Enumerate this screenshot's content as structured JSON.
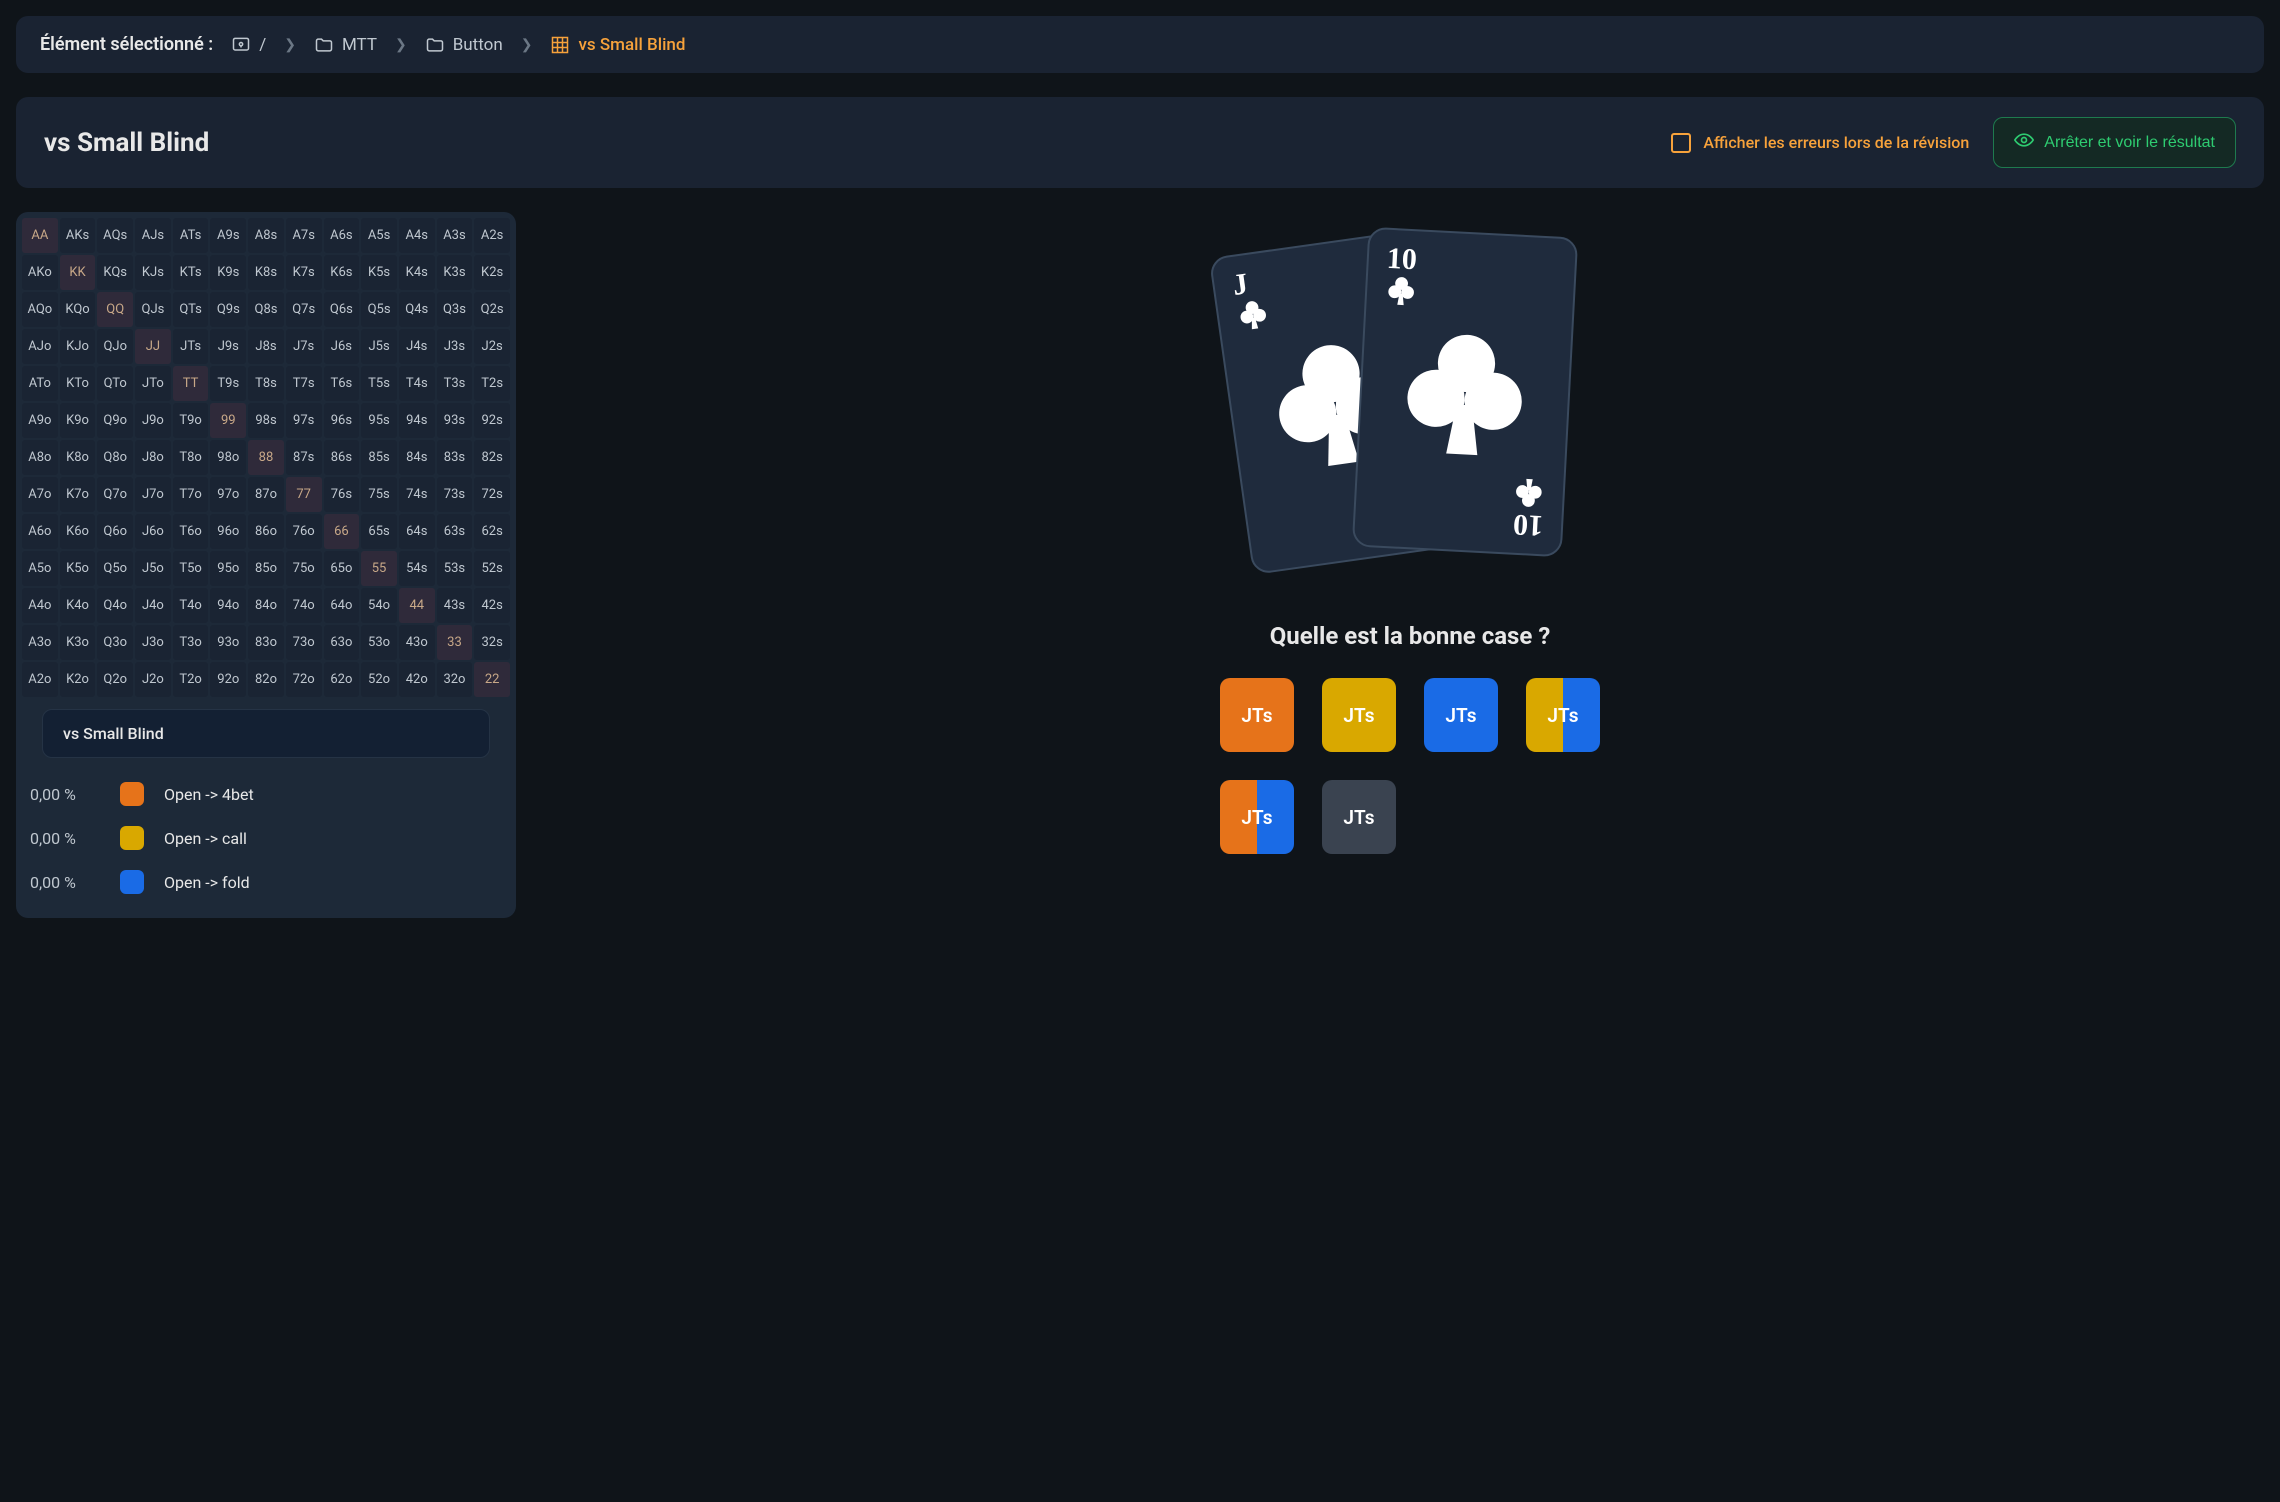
{
  "breadcrumb": {
    "label": "Élément sélectionné :",
    "root": "/",
    "items": [
      "MTT",
      "Button",
      "vs Small Blind"
    ]
  },
  "header": {
    "title": "vs Small Blind",
    "show_errors_label": "Afficher les erreurs lors de la révision",
    "stop_label": "Arrêter et voir le résultat"
  },
  "ranks": [
    "A",
    "K",
    "Q",
    "J",
    "T",
    "9",
    "8",
    "7",
    "6",
    "5",
    "4",
    "3",
    "2"
  ],
  "legend": {
    "title": "vs Small Blind",
    "rows": [
      {
        "pct": "0,00 %",
        "color": "orange",
        "label": "Open -> 4bet"
      },
      {
        "pct": "0,00 %",
        "color": "yellow",
        "label": "Open -> call"
      },
      {
        "pct": "0,00 %",
        "color": "blue",
        "label": "Open -> fold"
      }
    ]
  },
  "cards": {
    "c1_rank": "J",
    "c2_rank": "10",
    "c2_rank_bottom": "10"
  },
  "question": "Quelle est la bonne case ?",
  "answers": [
    {
      "label": "JTs",
      "fill": [
        [
          "orange",
          100
        ]
      ]
    },
    {
      "label": "JTs",
      "fill": [
        [
          "yellow",
          100
        ]
      ]
    },
    {
      "label": "JTs",
      "fill": [
        [
          "blue",
          100
        ]
      ]
    },
    {
      "label": "JTs",
      "fill": [
        [
          "yellow",
          50
        ],
        [
          "blue",
          50
        ]
      ]
    },
    {
      "label": "JTs",
      "fill": [
        [
          "orange",
          50
        ],
        [
          "blue",
          50
        ]
      ]
    },
    {
      "label": "JTs",
      "fill": [
        [
          "grey",
          100
        ]
      ]
    }
  ],
  "colors": {
    "orange": "#e6731a",
    "yellow": "#d9a800",
    "blue": "#1a6be6",
    "grey": "#3a4350"
  },
  "chart_data": {
    "type": "table",
    "note": "13x13 poker hand range matrix. Row i / column j (ranks A..2). Diagonal = pocket pairs. Upper triangle suited (s), lower offsuit (o). No color-weight data visible (all legend percentages 0,00 %)."
  }
}
